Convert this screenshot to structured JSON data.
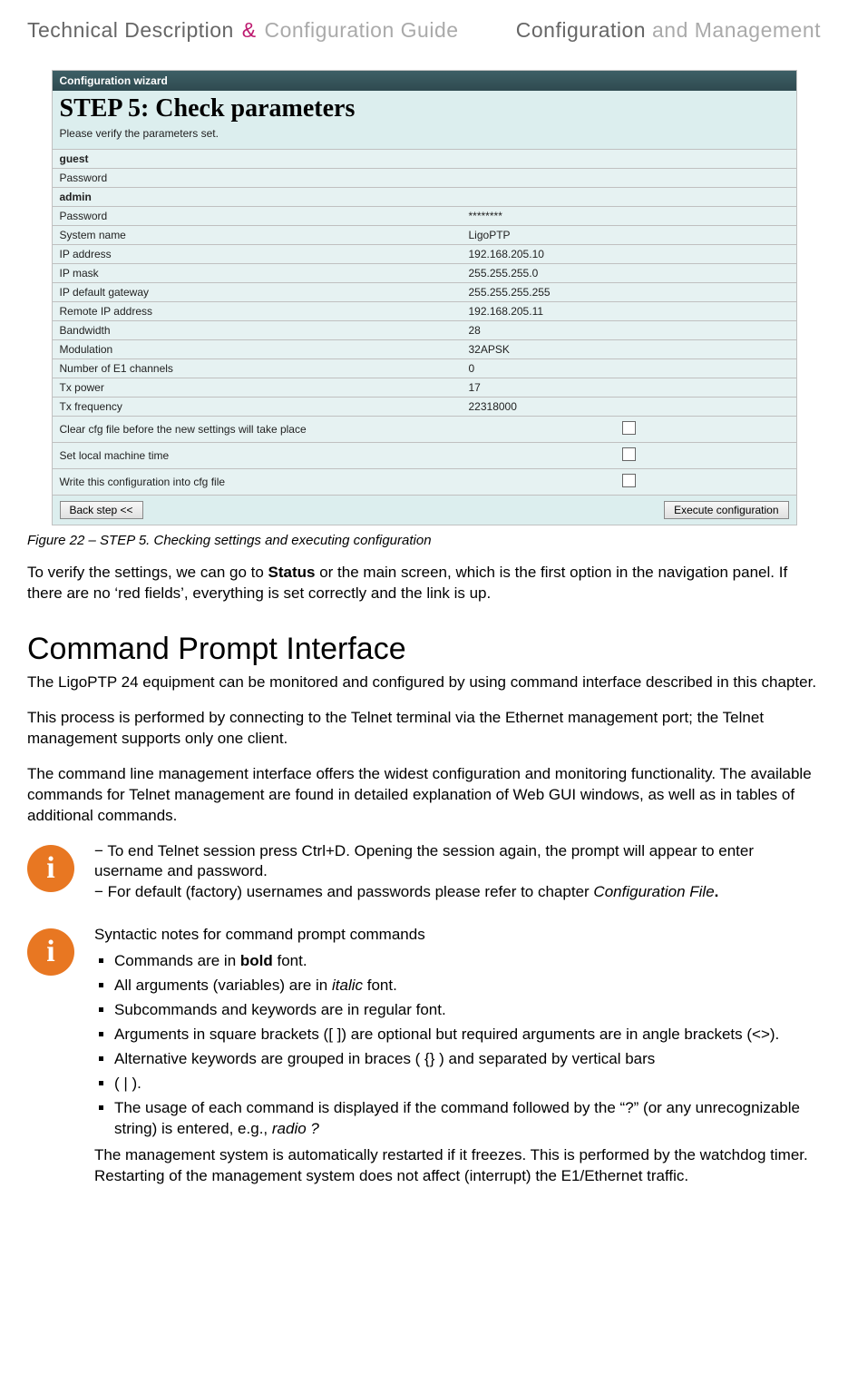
{
  "header": {
    "left_dark1": "Technical Description",
    "left_amp": "&",
    "left_light": "Configuration Guide",
    "right_dark": "Configuration",
    "right_light": " and Management"
  },
  "wizard": {
    "panel": "Configuration wizard",
    "title": "STEP 5: Check parameters",
    "subtitle": "Please verify the parameters set.",
    "sec1": "guest",
    "sec2": "admin",
    "rows1": [
      {
        "k": "Password",
        "v": ""
      }
    ],
    "rows2": [
      {
        "k": "Password",
        "v": "********"
      },
      {
        "k": "System name",
        "v": "LigoPTP"
      },
      {
        "k": "IP address",
        "v": "192.168.205.10"
      },
      {
        "k": "IP mask",
        "v": "255.255.255.0"
      },
      {
        "k": "IP default gateway",
        "v": "255.255.255.255"
      },
      {
        "k": "Remote IP address",
        "v": "192.168.205.11"
      },
      {
        "k": "Bandwidth",
        "v": "28"
      },
      {
        "k": "Modulation",
        "v": "32APSK"
      },
      {
        "k": "Number of E1 channels",
        "v": "0"
      },
      {
        "k": "Tx power",
        "v": "17"
      },
      {
        "k": "Tx frequency",
        "v": "22318000"
      }
    ],
    "checks": [
      "Clear cfg file before the new settings will take place",
      "Set local machine time",
      "Write this configuration into cfg file"
    ],
    "back_btn": "Back step <<",
    "exec_btn": "Execute configuration"
  },
  "figcap": "Figure 22 – STEP 5. Checking settings and executing configuration",
  "para1a": "To verify the settings, we can go to ",
  "para1b": "Status",
  "para1c": " or the main screen, which is the first option in the navigation panel. If there are no ‘red fields’, everything is set correctly and the link is up.",
  "h2": "Command Prompt Interface",
  "para2": "The LigoPTP 24 equipment can be monitored and configured by using command interface described in this chapter.",
  "para3": "This process is performed by connecting to the Telnet terminal via the Ethernet management port; the Telnet management supports only one client.",
  "para4": "The command line management interface offers the widest configuration and monitoring functionality. The available commands for Telnet management are found in detailed explanation of Web GUI windows, as well as in tables of additional commands.",
  "info1": {
    "l1": "− To end Telnet session press Ctrl+D. Opening the session again, the prompt will appear to enter username and password.",
    "l2a": "− For default (factory) usernames and passwords please refer to chapter ",
    "l2b": "Configuration File",
    "l2c": "."
  },
  "info2": {
    "head": "Syntactic notes for command prompt commands",
    "n1a": "Commands are in ",
    "n1b": "bold",
    "n1c": " font.",
    "n2a": "All arguments (variables) are in ",
    "n2b": "italic",
    "n2c": " font.",
    "n3": "Subcommands and keywords are in regular font.",
    "n4": "Arguments in square brackets ([ ]) are optional but required arguments are in angle brackets (<>).",
    "n5": "Alternative keywords are grouped in braces ( {} ) and separated by vertical bars",
    "n6": "( | ).",
    "n7a": "The usage of each command is displayed if the command followed by the “?” (or any unrecognizable string) is entered, e.g., ",
    "n7b": "radio ?",
    "tail": "The management system is automatically restarted if it freezes. This is performed by the watchdog timer. Restarting of the management system does not affect (interrupt) the E1/Ethernet traffic."
  }
}
